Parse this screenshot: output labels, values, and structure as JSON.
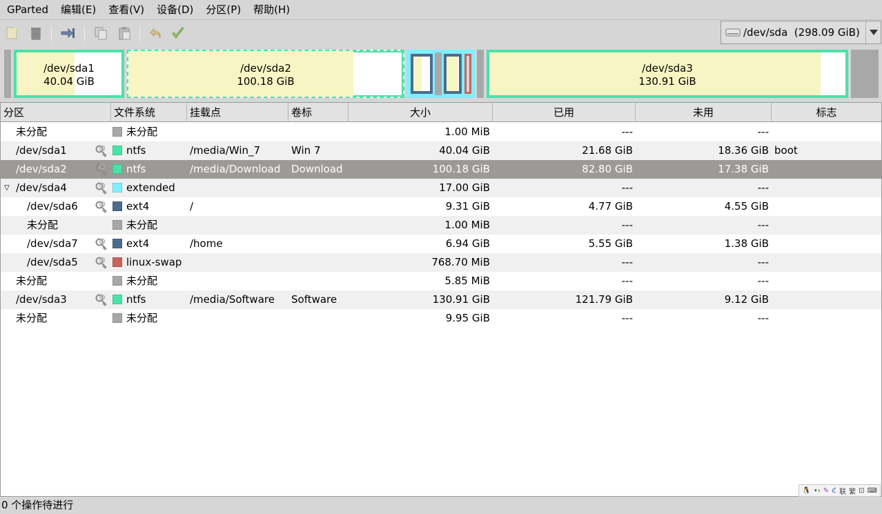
{
  "menubar": {
    "items": [
      {
        "name": "menu-gparted",
        "label": "GParted"
      },
      {
        "name": "menu-edit",
        "label": "编辑(E)"
      },
      {
        "name": "menu-view",
        "label": "查看(V)"
      },
      {
        "name": "menu-device",
        "label": "设备(D)"
      },
      {
        "name": "menu-partition",
        "label": "分区(P)"
      },
      {
        "name": "menu-help",
        "label": "帮助(H)"
      }
    ]
  },
  "toolbar": {
    "icons": [
      "new-icon",
      "delete-icon",
      "resize-move-icon",
      "copy-icon",
      "paste-icon",
      "undo-icon",
      "apply-icon"
    ]
  },
  "device": {
    "label": "/dev/sda  (298.09 GiB)",
    "icon": "harddisk-icon"
  },
  "diskmap": {
    "sda1": {
      "name": "/dev/sda1",
      "size": "40.04 GiB"
    },
    "sda2": {
      "name": "/dev/sda2",
      "size": "100.18 GiB"
    },
    "sda3": {
      "name": "/dev/sda3",
      "size": "130.91 GiB"
    }
  },
  "table": {
    "columns": [
      "分区",
      "文件系统",
      "挂载点",
      "卷标",
      "大小",
      "已用",
      "未用",
      "标志"
    ],
    "rows": [
      {
        "partition": "未分配",
        "fs": "未分配",
        "fs_color": "#a8a8a8",
        "mount": "",
        "label": "",
        "size": "1.00 MiB",
        "used": "---",
        "unused": "---",
        "flags": "",
        "key": false,
        "indent": 0
      },
      {
        "partition": "/dev/sda1",
        "fs": "ntfs",
        "fs_color": "#49e3a8",
        "mount": "/media/Win_7",
        "label": "Win 7",
        "size": "40.04 GiB",
        "used": "21.68 GiB",
        "unused": "18.36 GiB",
        "flags": "boot",
        "key": true,
        "indent": 0
      },
      {
        "partition": "/dev/sda2",
        "fs": "ntfs",
        "fs_color": "#49e3a8",
        "mount": "/media/Download",
        "label": "Download",
        "size": "100.18 GiB",
        "used": "82.80 GiB",
        "unused": "17.38 GiB",
        "flags": "",
        "key": true,
        "indent": 0
      },
      {
        "partition": "/dev/sda4",
        "fs": "extended",
        "fs_color": "#7ef0ff",
        "mount": "",
        "label": "",
        "size": "17.00 GiB",
        "used": "---",
        "unused": "---",
        "flags": "",
        "key": true,
        "indent": 0
      },
      {
        "partition": "/dev/sda6",
        "fs": "ext4",
        "fs_color": "#4c6c8e",
        "mount": "/",
        "label": "",
        "size": "9.31 GiB",
        "used": "4.77 GiB",
        "unused": "4.55 GiB",
        "flags": "",
        "key": true,
        "indent": 1
      },
      {
        "partition": "未分配",
        "fs": "未分配",
        "fs_color": "#a8a8a8",
        "mount": "",
        "label": "",
        "size": "1.00 MiB",
        "used": "---",
        "unused": "---",
        "flags": "",
        "key": false,
        "indent": 1
      },
      {
        "partition": "/dev/sda7",
        "fs": "ext4",
        "fs_color": "#4c6c8e",
        "mount": "/home",
        "label": "",
        "size": "6.94 GiB",
        "used": "5.55 GiB",
        "unused": "1.38 GiB",
        "flags": "",
        "key": true,
        "indent": 1
      },
      {
        "partition": "/dev/sda5",
        "fs": "linux-swap",
        "fs_color": "#c8645a",
        "mount": "",
        "label": "",
        "size": "768.70 MiB",
        "used": "---",
        "unused": "---",
        "flags": "",
        "key": true,
        "indent": 1
      },
      {
        "partition": "未分配",
        "fs": "未分配",
        "fs_color": "#a8a8a8",
        "mount": "",
        "label": "",
        "size": "5.85 MiB",
        "used": "---",
        "unused": "---",
        "flags": "",
        "key": false,
        "indent": 0
      },
      {
        "partition": "/dev/sda3",
        "fs": "ntfs",
        "fs_color": "#49e3a8",
        "mount": "/media/Software",
        "label": "Software",
        "size": "130.91 GiB",
        "used": "121.79 GiB",
        "unused": "9.12 GiB",
        "flags": "",
        "key": true,
        "indent": 0
      },
      {
        "partition": "未分配",
        "fs": "未分配",
        "fs_color": "#a8a8a8",
        "mount": "",
        "label": "",
        "size": "9.95 GiB",
        "used": "---",
        "unused": "---",
        "flags": "",
        "key": false,
        "indent": 0
      }
    ],
    "selected_row": 2,
    "expanded_row": 3
  },
  "statusbar": {
    "text": "0 个操作待进行"
  },
  "tray": {
    "labels": [
      "联",
      "繁"
    ]
  }
}
